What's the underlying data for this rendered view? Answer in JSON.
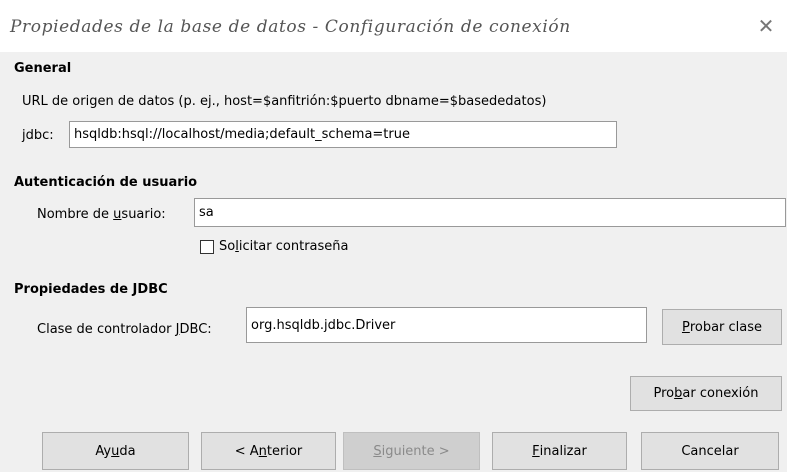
{
  "window": {
    "title": "Propiedades de la base de datos - Configuración de conexión",
    "close_glyph": "✕"
  },
  "general": {
    "heading": "General",
    "url_help": "URL de origen de datos (p. ej., host=$anfitrión:$puerto dbname=$basededatos)",
    "prefix": "jdbc:",
    "url_value": "hsqldb:hsql://localhost/media;default_schema=true"
  },
  "auth": {
    "heading": "Autenticación de usuario",
    "username_label_pre": "Nombre de ",
    "username_label_mnemonic": "u",
    "username_label_post": "suario:",
    "username_value": "sa",
    "password_checkbox_pre": "So",
    "password_checkbox_mnemonic": "l",
    "password_checkbox_post": "icitar contraseña",
    "password_checked": false
  },
  "jdbc": {
    "heading": "Propiedades de JDBC",
    "driver_label_pre": "Clase de controlador ",
    "driver_label_mnemonic": "J",
    "driver_label_post": "DBC:",
    "driver_value": "org.hsqldb.jdbc.Driver",
    "test_class_mnemonic": "P",
    "test_class_rest": "robar clase",
    "test_connection_pre": "Pro",
    "test_connection_mnemonic": "b",
    "test_connection_post": "ar conexión"
  },
  "footer": {
    "help_pre": "Ay",
    "help_mnemonic": "u",
    "help_post": "da",
    "back_pre": "< A",
    "back_mnemonic": "n",
    "back_post": "terior",
    "next_mnemonic": "S",
    "next_rest": "iguiente >",
    "finish_mnemonic": "F",
    "finish_rest": "inalizar",
    "cancel_label": "Cancelar"
  }
}
